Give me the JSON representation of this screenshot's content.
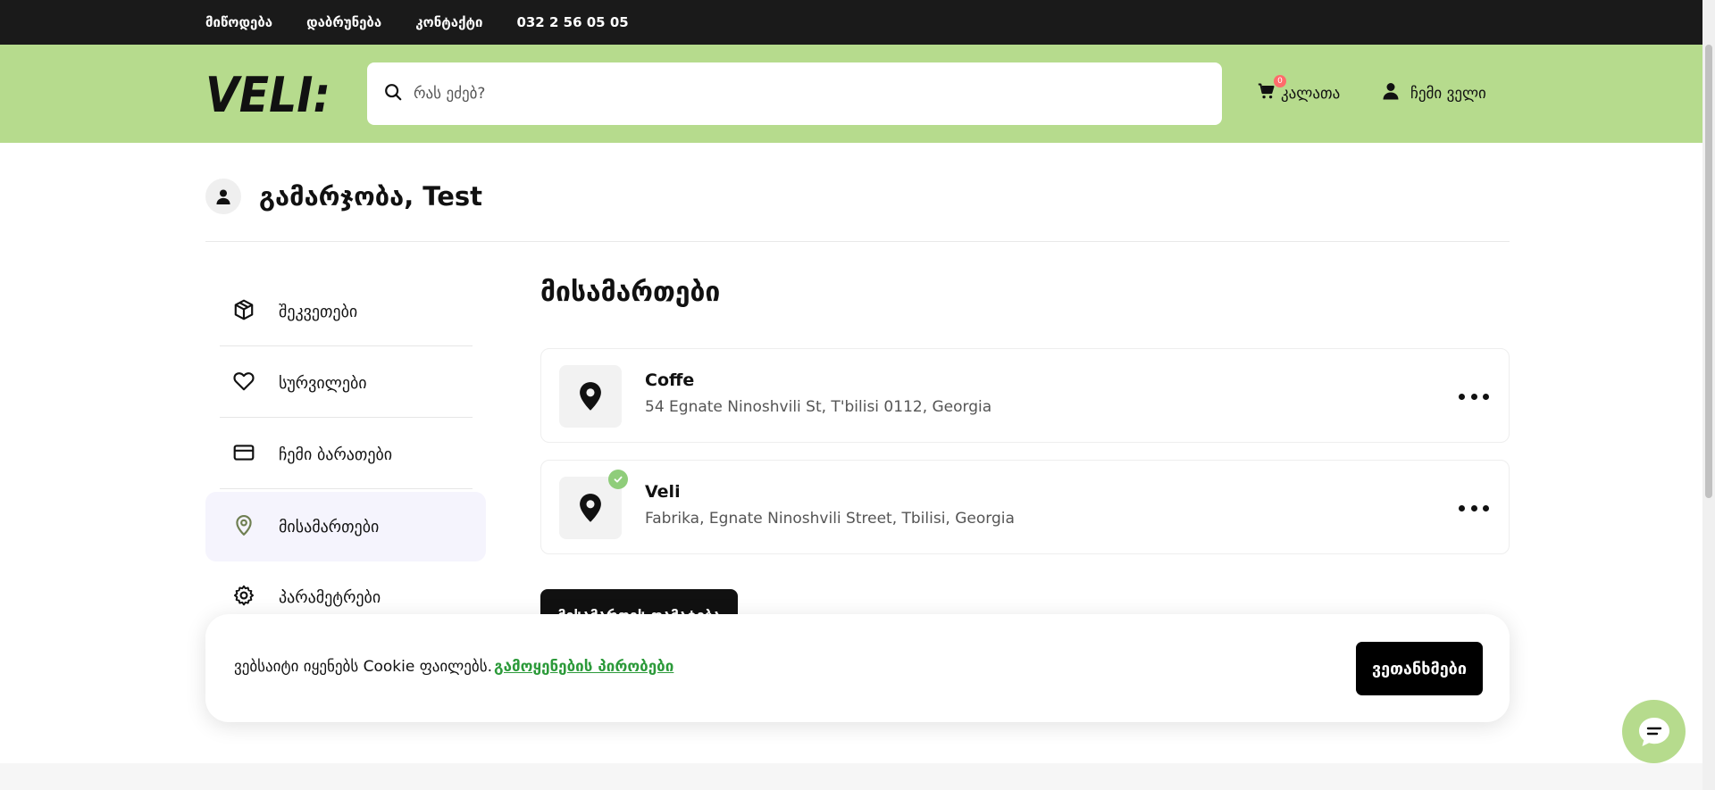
{
  "topbar": {
    "links": [
      "მიწოდება",
      "დაბრუნება",
      "კონტაქტი",
      "032 2 56 05 05"
    ]
  },
  "header": {
    "logo_text": "VELI:",
    "search_placeholder": "რას ეძებ?",
    "cart_label": "კალათა",
    "cart_count": "0",
    "account_label": "ჩემი ველი",
    "background": "#b6db8d"
  },
  "greeting": {
    "text": "გამარჯობა, Test"
  },
  "sidebar": {
    "items": [
      {
        "label": "შეკვეთები",
        "icon": "box-icon",
        "active": false
      },
      {
        "label": "სურვილები",
        "icon": "heart-icon",
        "active": false
      },
      {
        "label": "ჩემი ბარათები",
        "icon": "card-icon",
        "active": false
      },
      {
        "label": "მისამართები",
        "icon": "location-icon",
        "active": true
      },
      {
        "label": "პარამეტრები",
        "icon": "gear-icon",
        "active": false
      }
    ]
  },
  "main": {
    "title": "მისამართები",
    "addresses": [
      {
        "name": "Coffe",
        "address": "54 Egnate Ninoshvili St, T'bilisi 0112, Georgia",
        "default": false
      },
      {
        "name": "Veli",
        "address": "Fabrika, Egnate Ninoshvili Street, Tbilisi, Georgia",
        "default": true
      }
    ],
    "add_button_label": "მისამართის დამატება"
  },
  "cookie": {
    "text": "ვებსაიტი იყენებს Cookie ფაილებს.",
    "link_label": "გამოყენების პირობები",
    "accept_label": "ვეთანხმები",
    "link_color": "#2c9a3a"
  },
  "chat": {
    "icon": "chat-icon"
  }
}
